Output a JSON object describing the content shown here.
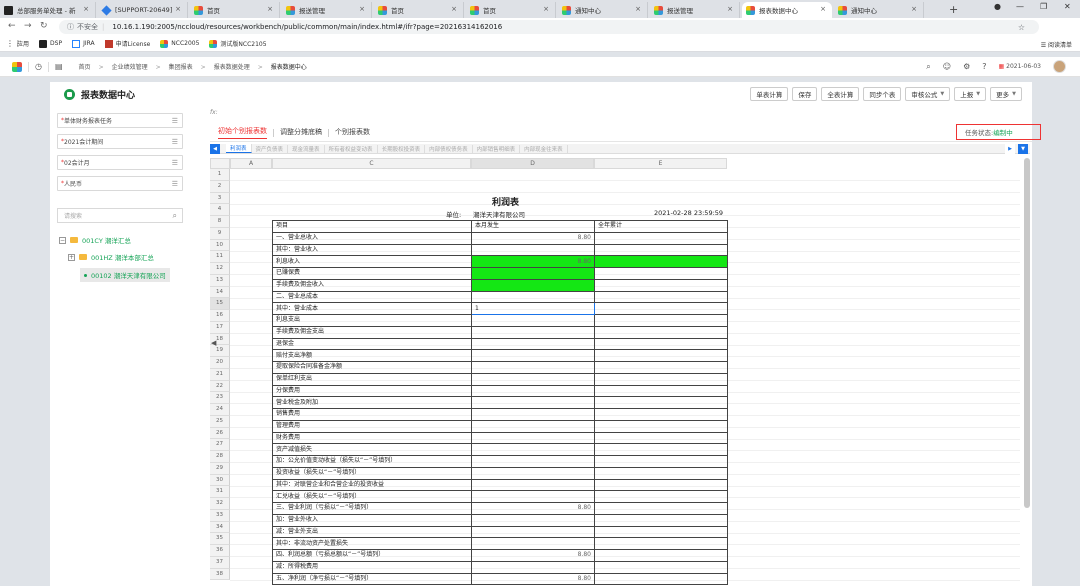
{
  "browser": {
    "tabs": [
      {
        "title": "总部服务单处理 - 新",
        "fav": "pro",
        "active": false
      },
      {
        "title": "[SUPPORT-20649] ",
        "fav": "sup",
        "active": false
      },
      {
        "title": "首页",
        "fav": "nc",
        "active": false
      },
      {
        "title": "报送管理",
        "fav": "nc",
        "active": false
      },
      {
        "title": "首页",
        "fav": "nc",
        "active": false
      },
      {
        "title": "首页",
        "fav": "nc",
        "active": false
      },
      {
        "title": "通知中心",
        "fav": "nc",
        "active": false
      },
      {
        "title": "报送管理",
        "fav": "nc",
        "active": false
      },
      {
        "title": "报表数据中心",
        "fav": "nc",
        "active": true
      },
      {
        "title": "通知中心",
        "fav": "nc",
        "active": false
      }
    ],
    "insecure_label": "不安全",
    "url": "10.16.1.190:2005/nccloud/resources/workbench/public/common/main/index.html#/ifr?page=20216314162016",
    "bookmarks": [
      "应用",
      "DSP",
      "JIRA",
      "申请License",
      "NCC2005",
      "测试版NCC2105"
    ],
    "reading_list": "阅读清单"
  },
  "app_header": {
    "breadcrumbs": [
      "首页",
      "企业绩效管理",
      "集团报表",
      "报表数据处理",
      "报表数据中心"
    ],
    "date": "2021-06-03"
  },
  "panel": {
    "title": "报表数据中心",
    "toolbar": [
      "单表计算",
      "保存",
      "全表计算",
      "同步个表",
      "审核公式",
      "上报",
      "更多"
    ],
    "toolbar_dropdowns": [
      false,
      false,
      false,
      false,
      true,
      true,
      true
    ],
    "fx_label": "fx:"
  },
  "sidebar": {
    "fields": [
      "单体财务报表任务",
      "2021会计期间",
      "02会计月",
      "人民币"
    ],
    "search_placeholder": "请搜索",
    "tree": [
      {
        "label": "001CY 潮洋汇总",
        "toggle": "−",
        "kind": "folder"
      },
      {
        "label": "001HZ 潮洋本部汇总",
        "toggle": "+",
        "kind": "folder"
      },
      {
        "label": "00102 潮洋天津有限公司",
        "toggle": "",
        "kind": "leaf"
      }
    ]
  },
  "report_tabs": [
    "初始个别报表数",
    "调整分摊底稿",
    "个别报表数"
  ],
  "task_status": {
    "label": "任务状态:",
    "value": "编制中"
  },
  "sheet_tabs": [
    "利润表",
    "资产负债表",
    "现金流量表",
    "所有者权益变动表",
    "长期股权投资表",
    "内部债权债务表",
    "内部销售明细表",
    "内部现金往来表"
  ],
  "columns": [
    "A",
    "B",
    "C",
    "D",
    "E"
  ],
  "row_numbers": [
    "1",
    "2",
    "3",
    "4",
    "8",
    "9",
    "10",
    "11",
    "12",
    "13",
    "14",
    "15",
    "16",
    "17",
    "18",
    "19",
    "20",
    "21",
    "22",
    "23",
    "24",
    "25",
    "26",
    "27",
    "28",
    "29",
    "30",
    "31",
    "32",
    "33",
    "34",
    "35",
    "36",
    "37",
    "38"
  ],
  "report": {
    "title": "利润表",
    "unit_label": "单位:",
    "company": "潮洋天津有限公司",
    "datetime": "2021-02-28 23:59:59",
    "headers": [
      "项目",
      "本月发生",
      "全年累计"
    ],
    "rows": [
      {
        "item": "一、营业总收入",
        "month": "8.80",
        "year": ""
      },
      {
        "item": "其中：营业收入",
        "month": "",
        "year": ""
      },
      {
        "item": "利息收入",
        "month": "8.80",
        "year": ""
      },
      {
        "item": "已赚保费",
        "month": "",
        "year": ""
      },
      {
        "item": "手续费及佣金收入",
        "month": "",
        "year": ""
      },
      {
        "item": "二、营业总成本",
        "month": "",
        "year": ""
      },
      {
        "item": "其中：营业成本",
        "month": "1",
        "year": ""
      },
      {
        "item": "利息支出",
        "month": "",
        "year": ""
      },
      {
        "item": "手续费及佣金支出",
        "month": "",
        "year": ""
      },
      {
        "item": "退保金",
        "month": "",
        "year": ""
      },
      {
        "item": "赔付支出净额",
        "month": "",
        "year": ""
      },
      {
        "item": "提取保险合同准备金净额",
        "month": "",
        "year": ""
      },
      {
        "item": "保单红利支出",
        "month": "",
        "year": ""
      },
      {
        "item": "分保费用",
        "month": "",
        "year": ""
      },
      {
        "item": "营业税金及附加",
        "month": "",
        "year": ""
      },
      {
        "item": "销售费用",
        "month": "",
        "year": ""
      },
      {
        "item": "管理费用",
        "month": "",
        "year": ""
      },
      {
        "item": "财务费用",
        "month": "",
        "year": ""
      },
      {
        "item": "资产减值损失",
        "month": "",
        "year": ""
      },
      {
        "item": "加：公允价值变动收益（损失以“－”号填列）",
        "month": "",
        "year": ""
      },
      {
        "item": "投资收益（损失以“－”号填列）",
        "month": "",
        "year": ""
      },
      {
        "item": "其中：对联营企业和合营企业的投资收益",
        "month": "",
        "year": ""
      },
      {
        "item": "汇兑收益（损失以“－”号填列）",
        "month": "",
        "year": ""
      },
      {
        "item": "三、营业利润（亏损以“－”号填列）",
        "month": "8.80",
        "year": ""
      },
      {
        "item": "加：营业外收入",
        "month": "",
        "year": ""
      },
      {
        "item": "减：营业外支出",
        "month": "",
        "year": ""
      },
      {
        "item": "其中：非流动资产处置损失",
        "month": "",
        "year": ""
      },
      {
        "item": "四、利润总额（亏损总额以“－”号填列）",
        "month": "8.80",
        "year": ""
      },
      {
        "item": "减：所得税费用",
        "month": "",
        "year": ""
      },
      {
        "item": "五、净利润（净亏损以“－”号填列）",
        "month": "8.80",
        "year": ""
      }
    ]
  },
  "colors": {
    "accent_green": "#15a356",
    "highlight_green": "#14e714",
    "status_red": "#e33333",
    "active_blue": "#1a73e8"
  }
}
